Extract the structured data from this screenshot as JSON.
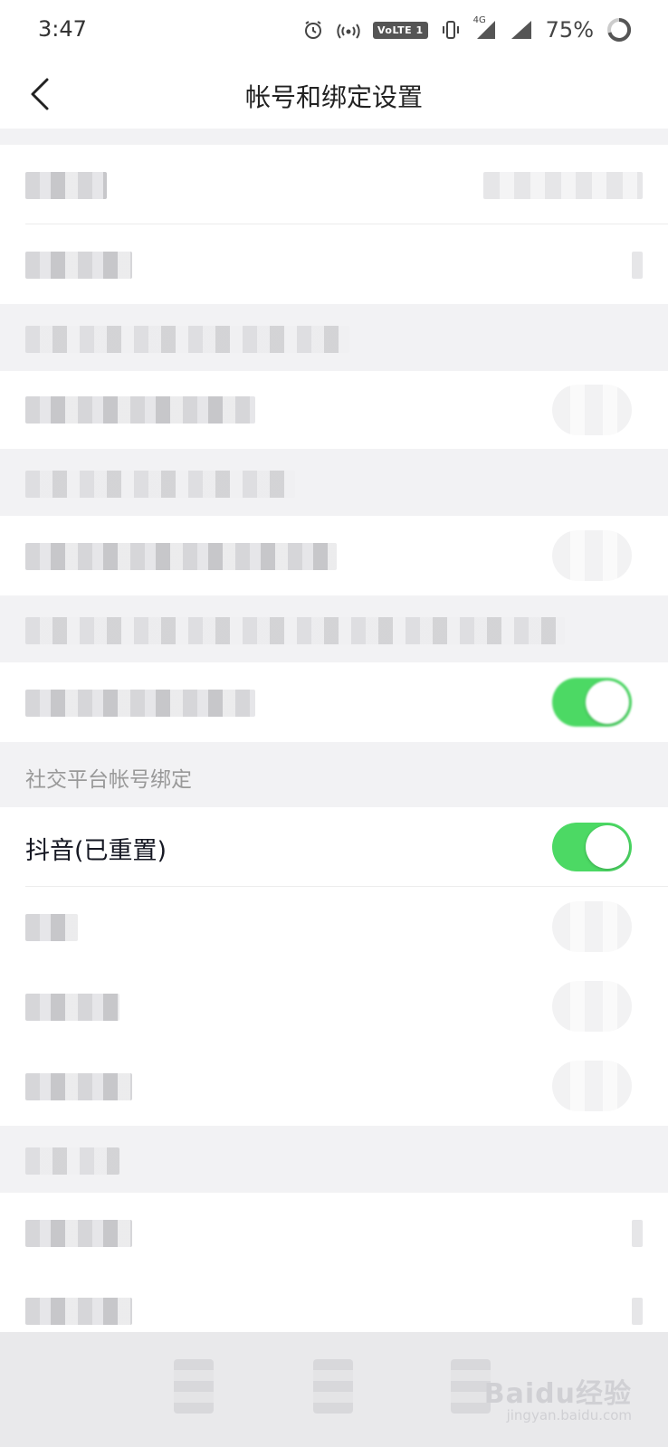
{
  "status_bar": {
    "time": "3:47",
    "volte_label": "VoLTE 1",
    "network_label": "4G",
    "battery": "75%"
  },
  "nav": {
    "title": "帐号和绑定设置"
  },
  "social_section": {
    "header": "社交平台帐号绑定",
    "douyin_label": "抖音(已重置)",
    "douyin_bound": true
  },
  "watermark": {
    "brand": "Baidu经验",
    "url": "jingyan.baidu.com"
  },
  "colors": {
    "toggle_on": "#4cd964",
    "section_bg": "#f2f2f4"
  }
}
